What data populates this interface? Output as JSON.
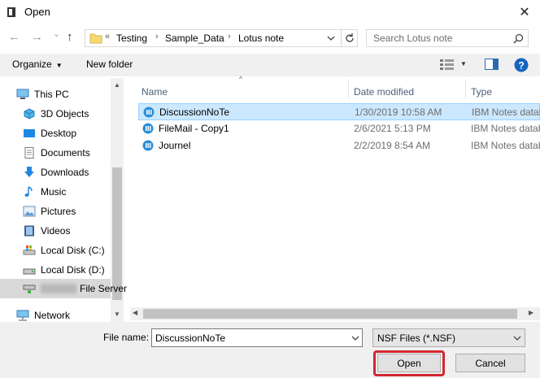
{
  "window": {
    "title": "Open",
    "close_glyph": "✕"
  },
  "nav": {
    "back": "←",
    "forward": "→",
    "recent": "⌄",
    "up": "↑"
  },
  "address": {
    "overflow": "«",
    "crumbs": [
      "Testing",
      "Sample_Data",
      "Lotus note"
    ],
    "sep": "›"
  },
  "search": {
    "placeholder": "Search Lotus note"
  },
  "toolbar": {
    "organize_label": "Organize",
    "new_folder_label": "New folder"
  },
  "sidebar": {
    "items": [
      {
        "label": "This PC",
        "icon": "pc-icon"
      },
      {
        "label": "3D Objects",
        "icon": "cube-icon"
      },
      {
        "label": "Desktop",
        "icon": "desktop-icon"
      },
      {
        "label": "Documents",
        "icon": "documents-icon"
      },
      {
        "label": "Downloads",
        "icon": "download-icon"
      },
      {
        "label": "Music",
        "icon": "music-icon"
      },
      {
        "label": "Pictures",
        "icon": "pictures-icon"
      },
      {
        "label": "Videos",
        "icon": "videos-icon"
      },
      {
        "label": "Local Disk (C:)",
        "icon": "drive-icon"
      },
      {
        "label": "Local Disk (D:)",
        "icon": "drive-icon"
      },
      {
        "label": "File Server",
        "icon": "network-drive-icon"
      },
      {
        "label": "Network",
        "icon": "network-icon"
      }
    ]
  },
  "columns": {
    "name": "Name",
    "date": "Date modified",
    "type": "Type"
  },
  "files": [
    {
      "name": "DiscussionNoTe",
      "date": "1/30/2019 10:58 AM",
      "type": "IBM Notes datab",
      "selected": true
    },
    {
      "name": "FileMail - Copy1",
      "date": "2/6/2021 5:13 PM",
      "type": "IBM Notes datab",
      "selected": false
    },
    {
      "name": "Journel",
      "date": "2/2/2019 8:54 AM",
      "type": "IBM Notes datab",
      "selected": false
    }
  ],
  "footer": {
    "filename_label": "File name:",
    "filename_value": "DiscussionNoTe",
    "filetype_value": "NSF Files (*.NSF)",
    "open_label": "Open",
    "cancel_label": "Cancel"
  },
  "colors": {
    "selection_bg": "#cce8ff",
    "selection_border": "#99d1ff",
    "highlight_red": "#d32630",
    "folder_yellow": "#f8d775"
  }
}
